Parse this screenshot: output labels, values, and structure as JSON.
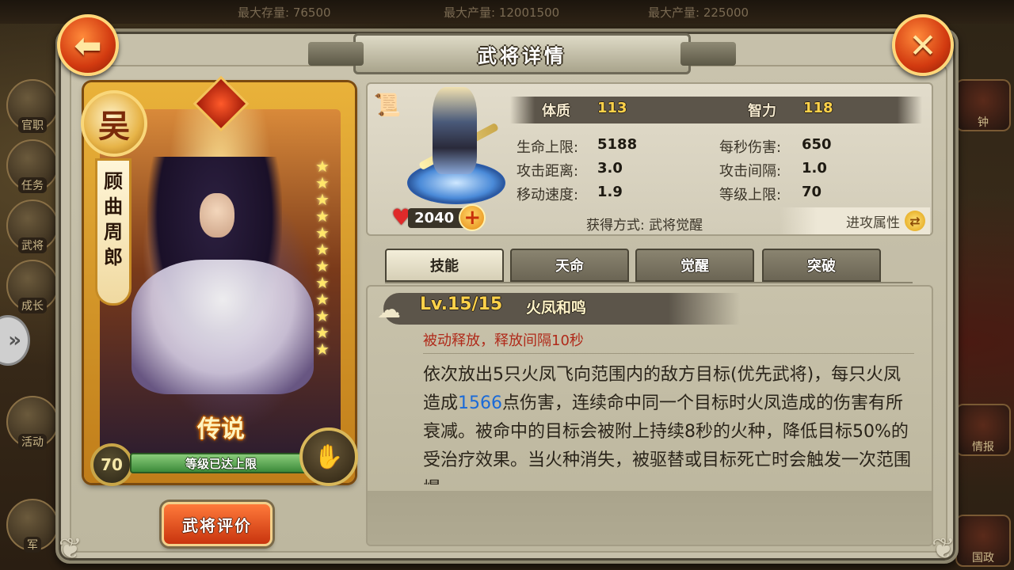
{
  "background": {
    "stats_top": [
      "最大存量: 76500",
      "最大产量: 12001500",
      "最大产量: 225000"
    ],
    "left_menu": [
      "官职",
      "任务",
      "武将",
      "成长",
      "活动",
      "军"
    ],
    "right_menu": [
      "钟",
      "情报",
      "国政"
    ]
  },
  "dialog": {
    "title": "武将详情",
    "back_icon": "arrow-left-icon",
    "close_icon": "close-x-icon"
  },
  "hero": {
    "faction": "吴",
    "name_chars": [
      "顾",
      "曲",
      "周",
      "郎"
    ],
    "rarity": "传说",
    "level": "70",
    "max_level_text": "等级已达上限",
    "stars": [
      "★",
      "★",
      "★",
      "★",
      "★",
      "★",
      "★",
      "★",
      "★",
      "★",
      "★",
      "★"
    ],
    "rate_button": "武将评价"
  },
  "stats": {
    "constitution_label": "体质",
    "constitution": "113",
    "intelligence_label": "智力",
    "intelligence": "118",
    "hp_max_label": "生命上限:",
    "hp_max": "5188",
    "dps_label": "每秒伤害:",
    "dps": "650",
    "range_label": "攻击距离:",
    "range": "3.0",
    "interval_label": "攻击间隔:",
    "interval": "1.0",
    "speed_label": "移动速度:",
    "speed": "1.9",
    "level_cap_label": "等级上限:",
    "level_cap": "70",
    "power": "2040",
    "obtain_label": "获得方式:",
    "obtain": "武将觉醒",
    "attr_toggle": "进攻属性"
  },
  "tabs": [
    "技能",
    "天命",
    "觉醒",
    "突破"
  ],
  "skill": {
    "level": "Lv.15/15",
    "name": "火凤和鸣",
    "trigger": "被动释放，释放间隔10秒",
    "desc_part1": "依次放出5只火凤飞向范围内的敌方目标(优先武将)，每只火凤造成",
    "desc_damage": "1566",
    "desc_part2": "点伤害，连续命中同一个目标时火凤造成的伤害有所衰减。被命中的目标会被附上持续8秒的火种，降低目标50%的受治疗效果。当火种消失，被驱替或目标死亡时会触发一次范围爆"
  },
  "colors": {
    "accent_orange": "#d23a10",
    "gold": "#ffd24a",
    "damage_blue": "#1a6ad8",
    "trigger_red": "#b02a1a"
  }
}
